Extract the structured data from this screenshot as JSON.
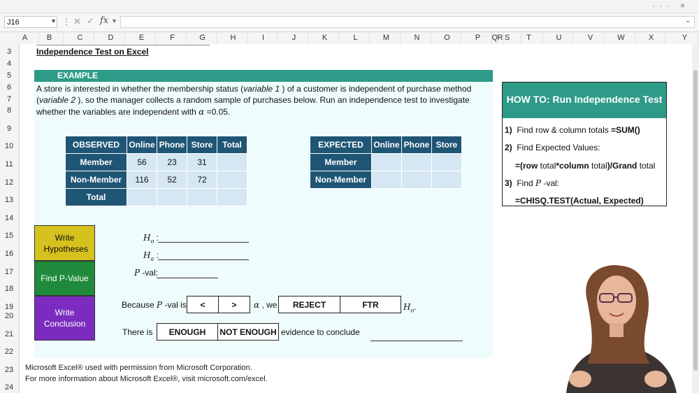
{
  "window": {
    "controls": "··· ×"
  },
  "formula_bar": {
    "cell_ref": "J16",
    "fx": "fx",
    "cancel": "✕",
    "enter": "✓",
    "value": ""
  },
  "columns": [
    "A",
    "B",
    "C",
    "D",
    "E",
    "F",
    "G",
    "H",
    "I",
    "J",
    "K",
    "L",
    "M",
    "N",
    "O",
    "P",
    "Q",
    "R",
    "S",
    "T",
    "U",
    "V",
    "W",
    "X",
    "Y"
  ],
  "rows": [
    "3",
    "4",
    "5",
    "6",
    "7",
    "8",
    "9",
    "10",
    "11",
    "12",
    "13",
    "14",
    "15",
    "16",
    "17",
    "18",
    "19",
    "20",
    "21",
    "22",
    "23",
    "24"
  ],
  "title": "Independence Test on Excel",
  "example_label": "EXAMPLE",
  "problem": {
    "l1a": "A store is interested in whether the membership status (",
    "l1b": "variable 1",
    "l1c": " ) of a customer is independent of purchase method",
    "l2a": "(",
    "l2b": "variable 2",
    "l2c": " ), so the manager collects a random sample of purchases below. Run an independence test to investigate",
    "l3a": "whether the variables are independent with ",
    "l3b": "α",
    "l3c": " =0.05."
  },
  "observed": {
    "header": [
      "OBSERVED",
      "Online",
      "Phone",
      "Store",
      "Total"
    ],
    "rows": [
      [
        "Member",
        "56",
        "23",
        "31",
        ""
      ],
      [
        "Non-Member",
        "116",
        "52",
        "72",
        ""
      ],
      [
        "Total",
        "",
        "",
        "",
        ""
      ]
    ]
  },
  "expected": {
    "header": [
      "EXPECTED",
      "Online",
      "Phone",
      "Store"
    ],
    "rows": [
      [
        "Member",
        "",
        "",
        ""
      ],
      [
        "Non-Member",
        "",
        "",
        ""
      ]
    ]
  },
  "steps": {
    "write_hypotheses": "Write Hypotheses",
    "find_pvalue": "Find P-Value",
    "write_conclusion": "Write Conclusion"
  },
  "hyp": {
    "h0": "H",
    "h0sub": "o",
    "ha": "H",
    "hasub": "a",
    "colon": " :",
    "pval_p": "P",
    "pval_rest": " -val:"
  },
  "conclusion": {
    "because": "Because ",
    "p": "P",
    "valis": " -val is",
    "lt": "<",
    "gt": ">",
    "alpha": "α",
    "we": " , we",
    "reject": "REJECT",
    "ftr": "FTR",
    "h0": "H",
    "h0sub": "o",
    "period": ".",
    "there_is": "There is",
    "enough": "ENOUGH",
    "not_enough": "NOT ENOUGH",
    "evidence": "evidence to conclude"
  },
  "howto": {
    "title": "HOW TO: Run Independence Test",
    "s1_num": "1)",
    "s1_text": "Find row & column totals ",
    "s1_code": "=SUM()",
    "s2_num": "2)",
    "s2_text": "Find Expected Values:",
    "s2_code_a": "=(row ",
    "s2_code_b": "total",
    "s2_code_c": "*column ",
    "s2_code_d": "total",
    "s2_code_e": ")/Grand ",
    "s2_code_f": "total",
    "s3_num": "3)",
    "s3_text_a": "Find ",
    "s3_text_p": "P",
    "s3_text_b": " -val:",
    "s3_code": "=CHISQ.TEST(Actual, Expected)"
  },
  "footer": {
    "line1": "Microsoft Excel® used with permission from Microsoft Corporation.",
    "line2": "For more information about Microsoft Excel®, visit microsoft.com/excel."
  },
  "colors": {
    "teal": "#2e9b88",
    "navy": "#1f5575",
    "lightblue": "#d5e7f3",
    "yellow": "#d6c21e",
    "green": "#1f8a3b",
    "purple": "#7b2cbf"
  }
}
